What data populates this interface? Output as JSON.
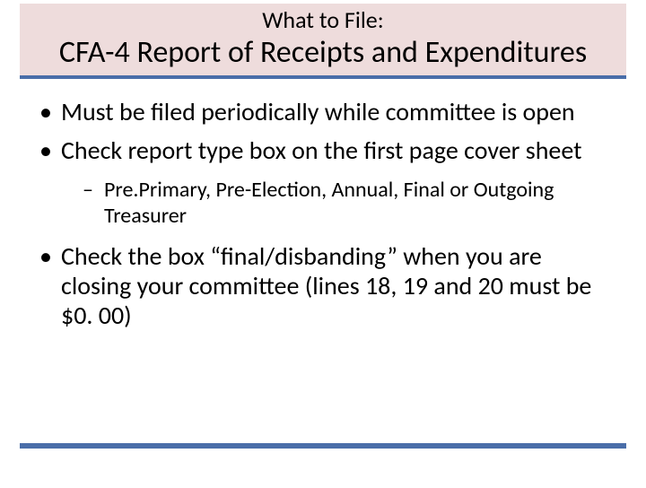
{
  "title": {
    "small": "What to File:",
    "big": "CFA-4 Report of Receipts and Expenditures"
  },
  "bullets": {
    "b1": "Must be filed periodically while committee is open",
    "b2": "Check report type box on the first page cover sheet",
    "b2_sub1": "Pre.Primary, Pre-Election, Annual, Final or Outgoing Treasurer",
    "b3": "Check the box “final/disbanding” when you are closing your committee (lines 18, 19 and 20 must be $0. 00)"
  }
}
